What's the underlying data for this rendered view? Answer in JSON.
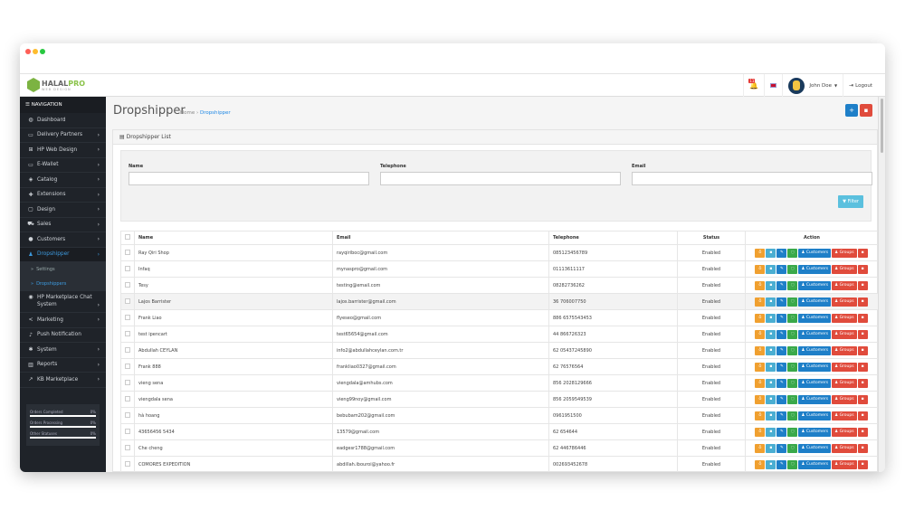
{
  "colors": {
    "sidebar": "#1f2329",
    "accent": "#1e88e5",
    "orange": "#f0a030",
    "cyan": "#4aaed2",
    "blue": "#1e7fc8",
    "green": "#3aa94a",
    "red": "#e04b3c"
  },
  "logo": {
    "brand": "HALAL",
    "brand2": "PRO",
    "tagline": "WEB DESIGN"
  },
  "header": {
    "badge": "11",
    "user": "John Doe",
    "logout": "Logout"
  },
  "sidebar": {
    "title": "NAVIGATION",
    "items": [
      {
        "label": "Dashboard",
        "icon": "dashboard-icon",
        "g": "◍"
      },
      {
        "label": "Delivery Partners",
        "icon": "credit-card-icon",
        "g": "▭",
        "ch": true
      },
      {
        "label": "HP Web Design",
        "icon": "windows-icon",
        "g": "⊞",
        "ch": true
      },
      {
        "label": "E-Wallet",
        "icon": "credit-card-icon",
        "g": "▭",
        "ch": true
      },
      {
        "label": "Catalog",
        "icon": "tags-icon",
        "g": "◈",
        "ch": true
      },
      {
        "label": "Extensions",
        "icon": "puzzle-icon",
        "g": "✚",
        "ch": true
      },
      {
        "label": "Design",
        "icon": "monitor-icon",
        "g": "▢",
        "ch": true
      },
      {
        "label": "Sales",
        "icon": "cart-icon",
        "g": "⛟",
        "ch": true
      },
      {
        "label": "Customers",
        "icon": "user-icon",
        "g": "●",
        "ch": true
      },
      {
        "label": "Dropshipper",
        "icon": "users-icon",
        "g": "♟",
        "ch": true,
        "active": true
      },
      {
        "label": "HP Marketplace Chat System",
        "icon": "comments-icon",
        "g": "◉",
        "ch": true,
        "two": true
      },
      {
        "label": "Marketing",
        "icon": "share-icon",
        "g": "<",
        "ch": true
      },
      {
        "label": "Push Notification",
        "icon": "bell-icon",
        "g": "♪"
      },
      {
        "label": "System",
        "icon": "cog-icon",
        "g": "✱",
        "ch": true
      },
      {
        "label": "Reports",
        "icon": "bar-chart-icon",
        "g": "▥",
        "ch": true
      },
      {
        "label": "KB Marketplace",
        "icon": "line-chart-icon",
        "g": "↗",
        "ch": true
      }
    ],
    "subitems": [
      "Settings",
      "Dropshippers"
    ],
    "stats": [
      {
        "label": "Orders Completed",
        "value": "0%"
      },
      {
        "label": "Orders Processing",
        "value": "0%"
      },
      {
        "label": "Other Statuses",
        "value": "0%"
      }
    ]
  },
  "page": {
    "title": "Dropshipper",
    "breadcrumb_home": "Home",
    "breadcrumb_current": "Dropshipper",
    "panel_title": "Dropshipper List"
  },
  "filter": {
    "name_label": "Name",
    "telephone_label": "Telephone",
    "email_label": "Email",
    "button": "Filter"
  },
  "table": {
    "headers": [
      "Name",
      "Email",
      "Telephone",
      "Status",
      "Action"
    ],
    "customers_btn": "Customers",
    "groups_btn": "Groups",
    "rows": [
      [
        "Ray Qiri Shop",
        "rayqiriboc@gmail.com",
        "085123456789",
        "Enabled"
      ],
      [
        "Infaq",
        "mynaspro@gmail.com",
        "01113611117",
        "Enabled"
      ],
      [
        "Tesy",
        "testing@email.com",
        "08282736262",
        "Enabled"
      ],
      [
        "Lajos Barrister",
        "lajos.barrister@gmail.com",
        "36 706007750",
        "Enabled"
      ],
      [
        "Frank Liao",
        "flyeseo@gmail.com",
        "886 6575543453",
        "Enabled"
      ],
      [
        "test ipencart",
        "test65654@gmail.com",
        "44 866726323",
        "Enabled"
      ],
      [
        "Abdullah CEYLAN",
        "info2@abdullahceylan.com.tr",
        "62 05437245890",
        "Enabled"
      ],
      [
        "Frank 888",
        "frankliao0327@gmail.com",
        "62 76576564",
        "Enabled"
      ],
      [
        "vieng sena",
        "viengdala@amhubs.com",
        "856 2028129666",
        "Enabled"
      ],
      [
        "viengdala sena",
        "vieng99noy@gmail.com",
        "856 2059549539",
        "Enabled"
      ],
      [
        "hà hoang",
        "bebubam202@gmail.com",
        "0961951500",
        "Enabled"
      ],
      [
        "43656456 5434",
        "13579@gmail.com",
        "62 654644",
        "Enabled"
      ],
      [
        "Che cheng",
        "eadgesr1788@gmail.com",
        "62 446786446",
        "Enabled"
      ],
      [
        "COMORES EXPEDITION",
        "abdillah.ibouroi@yahoo.fr",
        "002693452678",
        "Enabled"
      ]
    ]
  }
}
